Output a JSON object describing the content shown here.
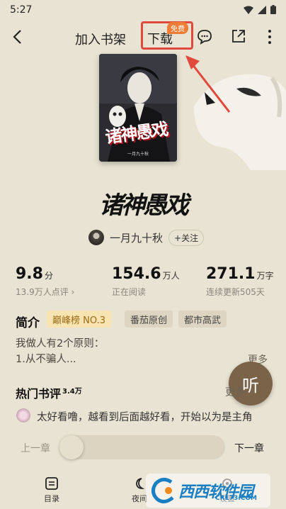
{
  "status_bar": {
    "time": "5:27"
  },
  "header": {
    "add_shelf_label": "加入书架",
    "download_label": "下载",
    "free_badge": "免费"
  },
  "book": {
    "cover_title": "诸神愚戏",
    "cover_author": "一月九十秋",
    "title": "诸神愚戏",
    "author": "一月九十秋",
    "follow_label": "+关注"
  },
  "stats": {
    "score": "9.8",
    "score_unit": "分",
    "rating_count": "13.9万人点评 ›",
    "readers": "154.6",
    "readers_unit": "万人",
    "readers_label": "正在阅读",
    "words": "271.1",
    "words_unit": "万字",
    "words_label": "连续更新505天"
  },
  "intro": {
    "label": "简介",
    "tags": [
      "巅峰榜 NO.3",
      "番茄原创",
      "都市高武"
    ],
    "text_line1": "我做人有2个原则：",
    "text_line2": "1.从不骗人...",
    "more": "更多"
  },
  "listen_label": "听",
  "reviews": {
    "label": "热门书评",
    "count": "3.4万",
    "more": "更多",
    "first_review": "太好看噜，越看到后面越好看，开始以为是主角"
  },
  "chapter_nav": {
    "prev": "上一章",
    "next": "下一章",
    "progress": 0
  },
  "bottom_nav": {
    "items": [
      {
        "label": "目录",
        "icon": "catalog-icon"
      },
      {
        "label": "夜间",
        "icon": "moon-icon"
      },
      {
        "label": "设置",
        "icon": "settings-icon"
      }
    ]
  },
  "watermark": {
    "text": "西西软件园",
    "sub": "CR173.COM"
  },
  "colors": {
    "background": "#e9e3d3",
    "highlight_box": "#e0493b",
    "free_badge": "#ef7d35",
    "listen_button": "#7a6348",
    "gold_tag_bg": "#f7e4b0",
    "gold_tag_text": "#9a6a14"
  }
}
